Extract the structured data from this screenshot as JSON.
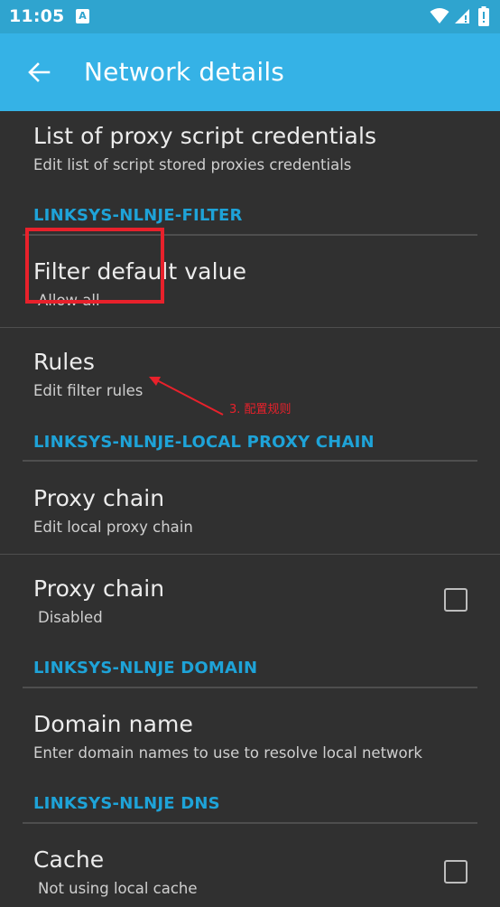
{
  "status_bar": {
    "time": "11:05",
    "notification_glyph": "A",
    "icons": [
      "notification-icon",
      "wifi-icon",
      "signal-icon",
      "battery-icon"
    ]
  },
  "app_bar": {
    "title": "Network details",
    "back_icon": "arrow-back-icon",
    "background": "#35b2e6",
    "status_background": "#2fa4cf"
  },
  "prefs": {
    "proxy_creds": {
      "title": "List of proxy script credentials",
      "summary": "Edit list of script stored proxies credentials"
    },
    "filter_category": "LINKSYS-NLNJE-FILTER",
    "filter_default": {
      "title": "Filter default value",
      "summary": "Allow all"
    },
    "rules": {
      "title": "Rules",
      "summary": "Edit filter rules"
    },
    "local_proxy_category": "LINKSYS-NLNJE-LOCAL PROXY CHAIN",
    "proxy_chain_edit": {
      "title": "Proxy chain",
      "summary": "Edit local proxy chain"
    },
    "proxy_chain_toggle": {
      "title": "Proxy chain",
      "summary": "Disabled",
      "checked": false
    },
    "domain_category": "LINKSYS-NLNJE DOMAIN",
    "domain_name": {
      "title": "Domain name",
      "summary": "Enter domain names to use to resolve local network"
    },
    "dns_category": "LINKSYS-NLNJE DNS",
    "cache": {
      "title": "Cache",
      "summary": "Not using local cache",
      "checked": false
    }
  },
  "annotation": {
    "text": "3. 配置规则",
    "color": "#e8212b"
  },
  "colors": {
    "background": "#303030",
    "accent": "#1ea3d8",
    "divider": "#4e4e4e"
  }
}
